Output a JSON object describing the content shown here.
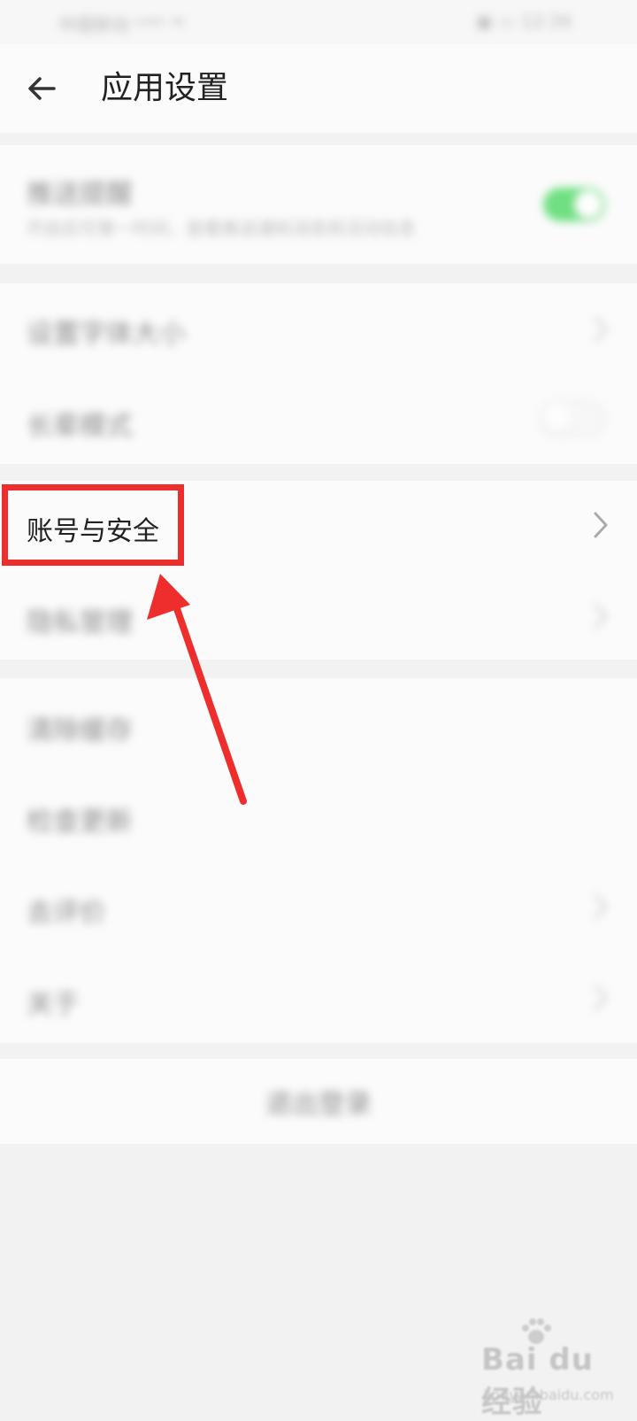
{
  "status_bar": {
    "left_text": "中国移动 ᵇᵈ⁴ᴳ ⁴⁶",
    "right_text": "▣ ▭ 12:34"
  },
  "header": {
    "back_icon": "arrow-left-icon",
    "title": "应用设置"
  },
  "groups": [
    {
      "items": [
        {
          "label": "推送提醒",
          "subtitle": "开启后可第一时间，查看推送通知消息和活动信息",
          "control": "toggle",
          "toggle_on": true,
          "blurred": true
        }
      ]
    },
    {
      "items": [
        {
          "label": "设置字体大小",
          "control": "chevron",
          "blurred": true
        },
        {
          "label": "长辈模式",
          "control": "toggle",
          "toggle_on": false,
          "blurred": true
        }
      ]
    },
    {
      "items": [
        {
          "label": "账号与安全",
          "control": "chevron",
          "blurred": false
        },
        {
          "label": "隐私管理",
          "control": "chevron",
          "blurred": true
        }
      ]
    },
    {
      "items": [
        {
          "label": "清除缓存",
          "control": "none",
          "blurred": true
        },
        {
          "label": "检查更新",
          "control": "none",
          "blurred": true
        },
        {
          "label": "去评价",
          "control": "chevron",
          "blurred": true
        },
        {
          "label": "关于",
          "control": "chevron",
          "blurred": true
        }
      ]
    }
  ],
  "logout": {
    "label": "退出登录"
  },
  "annotation": {
    "color": "#ee2d2d",
    "target": "账号与安全"
  },
  "colors": {
    "toggle_on": "#4cd964",
    "background": "#f2f2f2",
    "card": "#fbfbfb"
  },
  "watermark": {
    "logo": "Bai du 经验",
    "site": "jingyan.baidu.com"
  }
}
